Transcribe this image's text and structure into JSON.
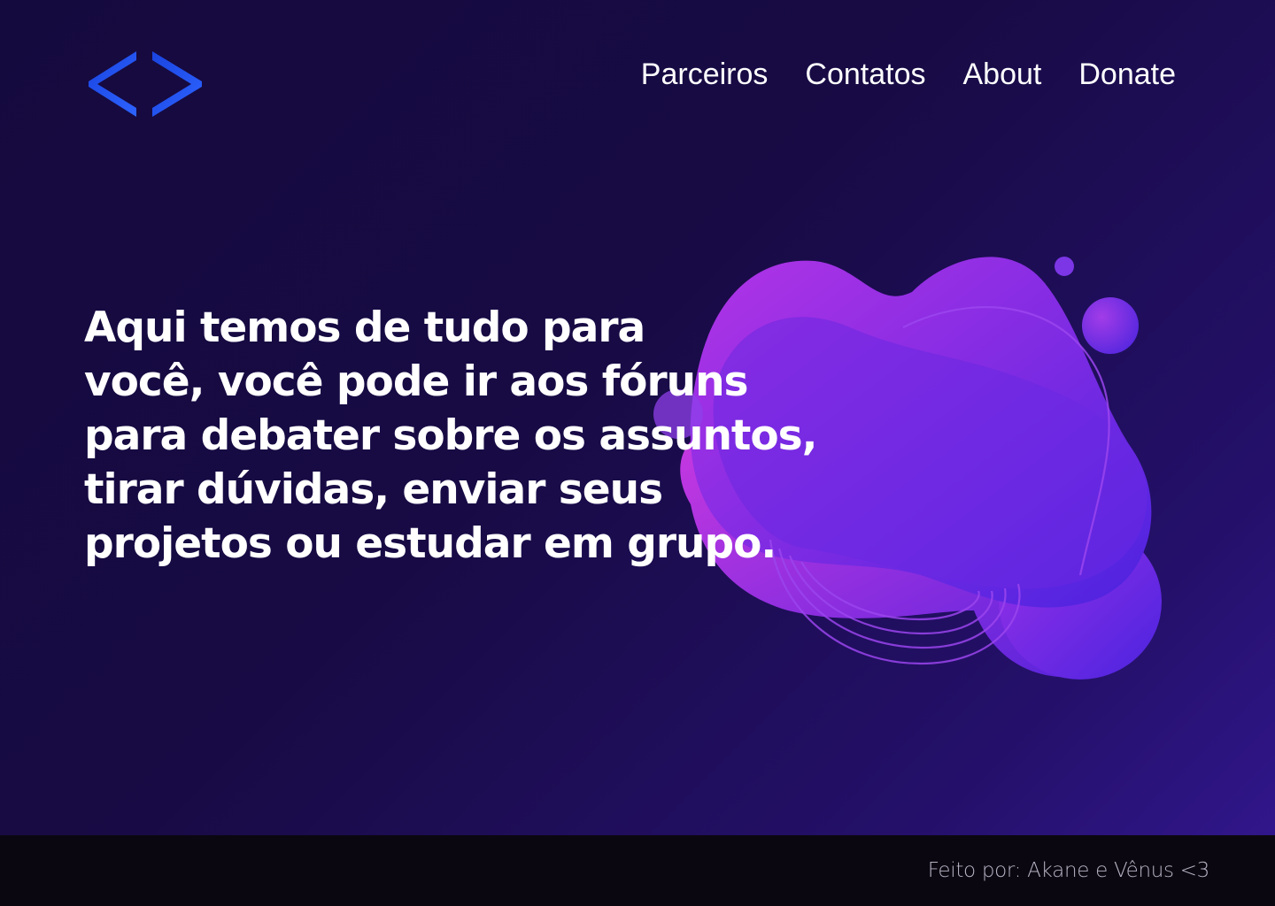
{
  "header": {
    "logo_icon": "code-brackets-icon",
    "logo_color": "#1e4fe8",
    "nav": [
      {
        "label": "Parceiros"
      },
      {
        "label": "Contatos"
      },
      {
        "label": "About"
      },
      {
        "label": "Donate"
      }
    ]
  },
  "hero": {
    "lines": [
      "Aqui temos de tudo para",
      "você, você pode ir aos fóruns",
      "para debater sobre os assuntos,",
      "tirar dúvidas, enviar seus",
      "projetos ou estudar em grupo."
    ]
  },
  "decoration": {
    "icon": "abstract-blob-illustration",
    "colors": [
      "#c433e6",
      "#8a2be2",
      "#5a24e0"
    ]
  },
  "footer": {
    "credit": "Feito por: Akane e Vênus <3"
  },
  "theme": {
    "background_dark": "#150a3e",
    "background_light": "#331791",
    "footer_bg": "#0b0710"
  }
}
